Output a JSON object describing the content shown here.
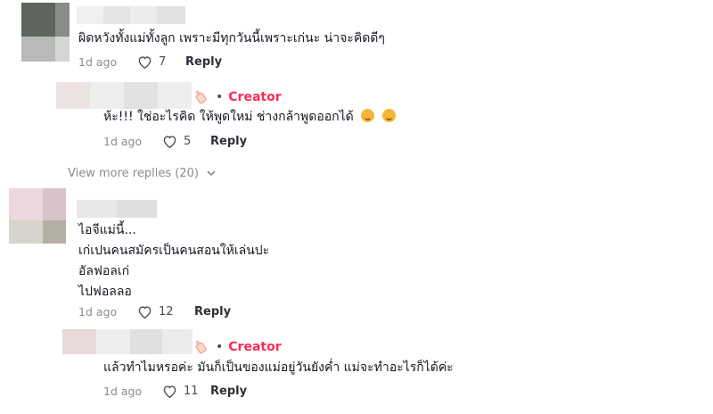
{
  "comments": [
    {
      "text_lines": [
        "ผิดหวังทั้งแม่ทั้งลูก เพราะมีทุกวันนี้เพราะเก่นะ น่าจะคิดดีๆ"
      ],
      "age": "1d ago",
      "likes": "7",
      "reply_label": "Reply"
    },
    {
      "creator_label": "Creator",
      "text_lines": [
        "ห้ะ!!! ใช่อะไรคิด ให้พูดใหม่ ช่างกล้าพูดออกได้"
      ],
      "emojis": [
        "smirk-emoji",
        "smirk-emoji"
      ],
      "age": "1d ago",
      "likes": "5",
      "reply_label": "Reply"
    },
    {
      "text_lines": [
        "ไอจีแม่นี้...",
        "เก่เปนคนสมัครเป็นคนสอนให้เล่นปะ",
        "อัลฟอลเก่",
        "ไปฟอลลอ"
      ],
      "age": "1d ago",
      "likes": "12",
      "reply_label": "Reply"
    },
    {
      "creator_label": "Creator",
      "text_lines": [
        "แล้วทำไมหรอค่ะ มันก็เป็นของแม่อยู่วันยังค่ำ แม่จะทำอะไรก็ได้ค่ะ"
      ],
      "age": "1d ago",
      "likes": "11",
      "reply_label": "Reply"
    }
  ],
  "view_more": "View more replies (20)",
  "colors": {
    "creator": "#fe2c55",
    "meta": "#8a8b91",
    "text": "#161823"
  }
}
